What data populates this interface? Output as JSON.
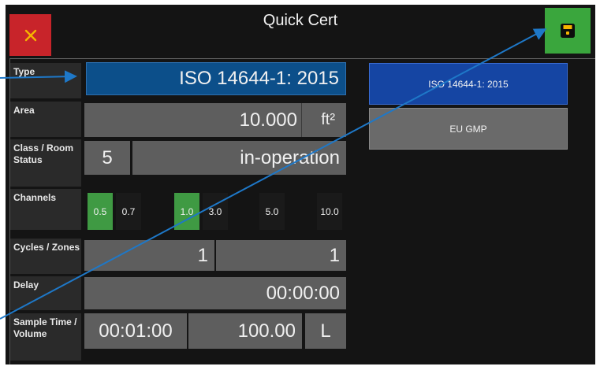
{
  "header": {
    "title": "Quick Cert"
  },
  "icons": {
    "close": "close-icon",
    "save": "save-icon"
  },
  "colors": {
    "close": "#c8242a",
    "save": "#3aa63d",
    "selected": "#1545a3",
    "channel_on": "#3f9a43"
  },
  "form": {
    "type": {
      "label": "Type",
      "value": "ISO 14644-1: 2015"
    },
    "area": {
      "label": "Area",
      "value": "10.000",
      "unit": "ft²"
    },
    "class": {
      "label": "Class / Room Status",
      "value": "5",
      "status": "in-operation"
    },
    "channels": {
      "label": "Channels",
      "items": [
        {
          "label": "0.5",
          "active": true
        },
        {
          "label": "0.7",
          "active": false
        },
        {
          "label": "1.0",
          "active": true
        },
        {
          "label": "3.0",
          "active": false
        },
        {
          "label": "5.0",
          "active": false
        },
        {
          "label": "10.0",
          "active": false
        }
      ]
    },
    "cycles": {
      "label": "Cycles / Zones",
      "cycles": "1",
      "zones": "1"
    },
    "delay": {
      "label": "Delay",
      "value": "00:00:00"
    },
    "sample": {
      "label": "Sample Time / Volume",
      "time": "00:01:00",
      "volume": "100.00",
      "unit": "L"
    }
  },
  "standards": [
    {
      "label": "ISO 14644-1: 2015",
      "selected": true
    },
    {
      "label": "EU GMP",
      "selected": false
    }
  ]
}
